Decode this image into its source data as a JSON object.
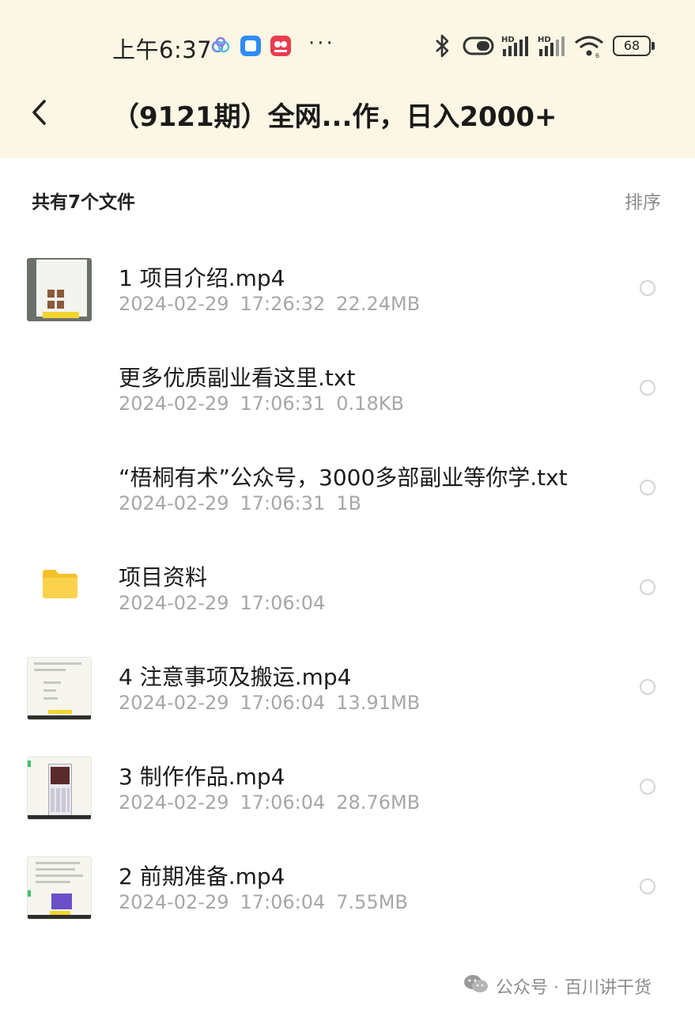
{
  "status_bar": {
    "time": "上午6:37",
    "more": "···",
    "battery": "68"
  },
  "header": {
    "title": "（9121期）全网...作，日入2000+"
  },
  "list": {
    "count_label": "共有7个文件",
    "sort_label": "排序"
  },
  "files": [
    {
      "name": "1 项目介绍.mp4",
      "date": "2024-02-29",
      "time": "17:26:32",
      "size": "22.24MB",
      "type": "video"
    },
    {
      "name": "更多优质副业看这里.txt",
      "date": "2024-02-29",
      "time": "17:06:31",
      "size": "0.18KB",
      "type": "text"
    },
    {
      "name": "“梧桐有术”公众号，3000多部副业等你学.txt",
      "date": "2024-02-29",
      "time": "17:06:31",
      "size": "1B",
      "type": "text"
    },
    {
      "name": "项目资料",
      "date": "2024-02-29",
      "time": "17:06:04",
      "size": "",
      "type": "folder"
    },
    {
      "name": "4 注意事项及搬运.mp4",
      "date": "2024-02-29",
      "time": "17:06:04",
      "size": "13.91MB",
      "type": "video"
    },
    {
      "name": "3 制作作品.mp4",
      "date": "2024-02-29",
      "time": "17:06:04",
      "size": "28.76MB",
      "type": "video"
    },
    {
      "name": "2 前期准备.mp4",
      "date": "2024-02-29",
      "time": "17:06:04",
      "size": "7.55MB",
      "type": "video"
    }
  ],
  "watermark": {
    "text": "公众号 · 百川讲干货"
  },
  "colors": {
    "header_bg": "#fbf7e4",
    "folder": "#f9cf3d",
    "meta_text": "#a7a7a7"
  }
}
